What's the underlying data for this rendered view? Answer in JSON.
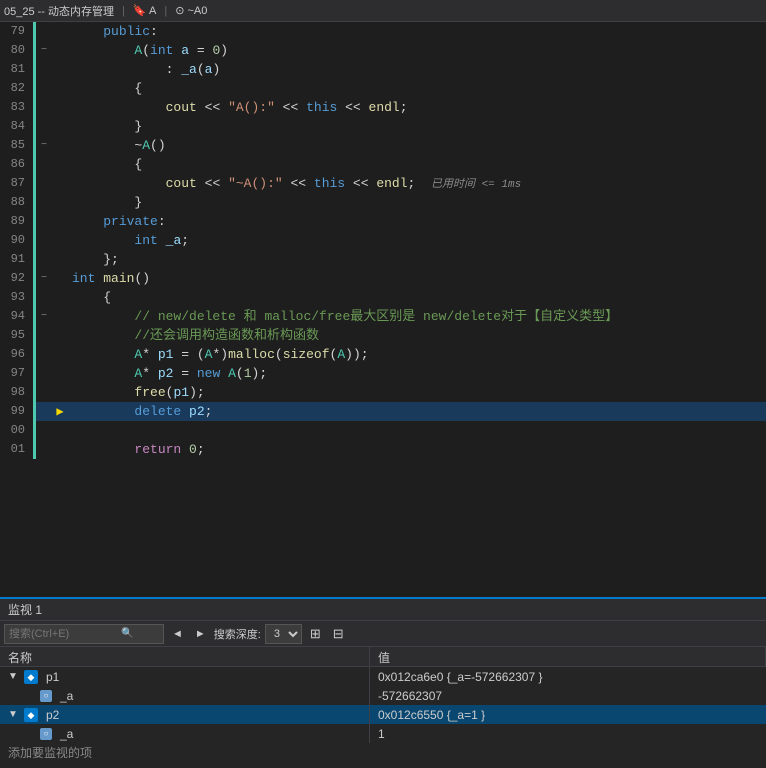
{
  "titlebar": {
    "left": "05_25 -- 动态内存管理",
    "middle": "🔖 A",
    "right": "⊙ ~A0"
  },
  "code": {
    "lines": [
      {
        "num": "79",
        "fold": "",
        "bp": "",
        "indent": 1,
        "tokens": [
          {
            "t": "kw",
            "v": "public"
          },
          {
            "t": "punc",
            "v": ":"
          }
        ]
      },
      {
        "num": "80",
        "fold": "−",
        "bp": "",
        "indent": 2,
        "tokens": [
          {
            "t": "type",
            "v": "A"
          },
          {
            "t": "punc",
            "v": "("
          },
          {
            "t": "kw",
            "v": "int"
          },
          {
            "t": "punc",
            "v": " "
          },
          {
            "t": "var",
            "v": "a"
          },
          {
            "t": "punc",
            "v": " = "
          },
          {
            "t": "num",
            "v": "0"
          },
          {
            "t": "punc",
            "v": ")"
          }
        ]
      },
      {
        "num": "81",
        "fold": "",
        "bp": "",
        "indent": 3,
        "tokens": [
          {
            "t": "punc",
            "v": ": "
          },
          {
            "t": "var",
            "v": "_a"
          },
          {
            "t": "punc",
            "v": "("
          },
          {
            "t": "var",
            "v": "a"
          },
          {
            "t": "punc",
            "v": ")"
          }
        ]
      },
      {
        "num": "82",
        "fold": "",
        "bp": "",
        "indent": 2,
        "tokens": [
          {
            "t": "punc",
            "v": "{"
          }
        ]
      },
      {
        "num": "83",
        "fold": "",
        "bp": "",
        "indent": 3,
        "tokens": [
          {
            "t": "macro",
            "v": "cout"
          },
          {
            "t": "op",
            "v": " << "
          },
          {
            "t": "str",
            "v": "\"A():\""
          },
          {
            "t": "op",
            "v": " << "
          },
          {
            "t": "this-kw",
            "v": "this"
          },
          {
            "t": "op",
            "v": " << "
          },
          {
            "t": "macro",
            "v": "endl"
          },
          {
            "t": "punc",
            "v": ";"
          }
        ]
      },
      {
        "num": "84",
        "fold": "",
        "bp": "",
        "indent": 2,
        "tokens": [
          {
            "t": "punc",
            "v": "}"
          }
        ]
      },
      {
        "num": "85",
        "fold": "−",
        "bp": "",
        "indent": 2,
        "tokens": [
          {
            "t": "punc",
            "v": "~"
          },
          {
            "t": "type",
            "v": "A"
          },
          {
            "t": "punc",
            "v": "()"
          }
        ]
      },
      {
        "num": "86",
        "fold": "",
        "bp": "",
        "indent": 2,
        "tokens": [
          {
            "t": "punc",
            "v": "{"
          }
        ]
      },
      {
        "num": "87",
        "fold": "",
        "bp": "",
        "indent": 3,
        "tokens": [
          {
            "t": "macro",
            "v": "cout"
          },
          {
            "t": "op",
            "v": " << "
          },
          {
            "t": "str",
            "v": "\"~A():\""
          },
          {
            "t": "op",
            "v": " << "
          },
          {
            "t": "this-kw",
            "v": "this"
          },
          {
            "t": "op",
            "v": " << "
          },
          {
            "t": "macro",
            "v": "endl"
          },
          {
            "t": "punc",
            "v": ";"
          }
        ],
        "timing": "已用时间 <= 1ms"
      },
      {
        "num": "88",
        "fold": "",
        "bp": "",
        "indent": 2,
        "tokens": [
          {
            "t": "punc",
            "v": "}"
          }
        ]
      },
      {
        "num": "89",
        "fold": "",
        "bp": "",
        "indent": 1,
        "tokens": [
          {
            "t": "kw",
            "v": "private"
          },
          {
            "t": "punc",
            "v": ":"
          }
        ]
      },
      {
        "num": "90",
        "fold": "",
        "bp": "",
        "indent": 2,
        "tokens": [
          {
            "t": "kw",
            "v": "int"
          },
          {
            "t": "punc",
            "v": " "
          },
          {
            "t": "var",
            "v": "_a"
          },
          {
            "t": "punc",
            "v": ";"
          }
        ]
      },
      {
        "num": "91",
        "fold": "",
        "bp": "",
        "indent": 1,
        "tokens": [
          {
            "t": "punc",
            "v": "};"
          }
        ]
      },
      {
        "num": "92",
        "fold": "−",
        "bp": "",
        "indent": 0,
        "tokens": [
          {
            "t": "kw",
            "v": "int"
          },
          {
            "t": "punc",
            "v": " "
          },
          {
            "t": "fn",
            "v": "main"
          },
          {
            "t": "punc",
            "v": "()"
          }
        ]
      },
      {
        "num": "93",
        "fold": "",
        "bp": "",
        "indent": 1,
        "tokens": [
          {
            "t": "punc",
            "v": "{"
          }
        ]
      },
      {
        "num": "94",
        "fold": "−",
        "bp": "",
        "indent": 2,
        "tokens": [
          {
            "t": "cmt",
            "v": "// new/delete 和 malloc/free最大区别是 new/delete对于【自定义类型】"
          }
        ]
      },
      {
        "num": "95",
        "fold": "",
        "bp": "",
        "indent": 2,
        "tokens": [
          {
            "t": "cmt",
            "v": "//还会调用构造函数和析构函数"
          }
        ]
      },
      {
        "num": "96",
        "fold": "",
        "bp": "",
        "indent": 2,
        "tokens": [
          {
            "t": "type",
            "v": "A"
          },
          {
            "t": "punc",
            "v": "* "
          },
          {
            "t": "var",
            "v": "p1"
          },
          {
            "t": "punc",
            "v": " = ("
          },
          {
            "t": "type",
            "v": "A"
          },
          {
            "t": "punc",
            "v": "*)"
          },
          {
            "t": "fn",
            "v": "malloc"
          },
          {
            "t": "punc",
            "v": "("
          },
          {
            "t": "fn",
            "v": "sizeof"
          },
          {
            "t": "punc",
            "v": "("
          },
          {
            "t": "type",
            "v": "A"
          },
          {
            "t": "punc",
            "v": "));"
          }
        ]
      },
      {
        "num": "97",
        "fold": "",
        "bp": "",
        "indent": 2,
        "tokens": [
          {
            "t": "type",
            "v": "A"
          },
          {
            "t": "punc",
            "v": "* "
          },
          {
            "t": "var",
            "v": "p2"
          },
          {
            "t": "punc",
            "v": " = "
          },
          {
            "t": "kw",
            "v": "new"
          },
          {
            "t": "punc",
            "v": " "
          },
          {
            "t": "type",
            "v": "A"
          },
          {
            "t": "punc",
            "v": "("
          },
          {
            "t": "num",
            "v": "1"
          },
          {
            "t": "punc",
            "v": ");"
          }
        ]
      },
      {
        "num": "98",
        "fold": "",
        "bp": "",
        "indent": 2,
        "tokens": [
          {
            "t": "fn",
            "v": "free"
          },
          {
            "t": "punc",
            "v": "("
          },
          {
            "t": "var",
            "v": "p1"
          },
          {
            "t": "punc",
            "v": ");"
          }
        ]
      },
      {
        "num": "99",
        "fold": "",
        "bp": "▶",
        "indent": 2,
        "tokens": [
          {
            "t": "kw",
            "v": "delete"
          },
          {
            "t": "punc",
            "v": " "
          },
          {
            "t": "var",
            "v": "p2"
          },
          {
            "t": "punc",
            "v": ";"
          }
        ],
        "current": true
      },
      {
        "num": "00",
        "fold": "",
        "bp": "",
        "indent": 0,
        "tokens": []
      },
      {
        "num": "01",
        "fold": "",
        "bp": "",
        "indent": 2,
        "tokens": [
          {
            "t": "kw2",
            "v": "return"
          },
          {
            "t": "punc",
            "v": " "
          },
          {
            "t": "num",
            "v": "0"
          },
          {
            "t": "punc",
            "v": ";"
          }
        ]
      }
    ]
  },
  "watch": {
    "title": "监视 1",
    "search_placeholder": "搜索(Ctrl+E)",
    "search_depth_label": "搜索深度:",
    "search_depth_value": "3",
    "col_name": "名称",
    "col_value": "值",
    "rows": [
      {
        "id": "p1",
        "indent": 0,
        "expanded": true,
        "label": "p1",
        "value": "0x012ca6e0 {_a=-572662307 }",
        "selected": false
      },
      {
        "id": "p1_a",
        "indent": 1,
        "expanded": false,
        "label": "_a",
        "value": "-572662307",
        "selected": false
      },
      {
        "id": "p2",
        "indent": 0,
        "expanded": true,
        "label": "p2",
        "value": "0x012c6550 {_a=1 }",
        "selected": true
      },
      {
        "id": "p2_a",
        "indent": 1,
        "expanded": false,
        "label": "_a",
        "value": "1",
        "selected": false
      }
    ],
    "add_label": "添加要监视的项"
  }
}
